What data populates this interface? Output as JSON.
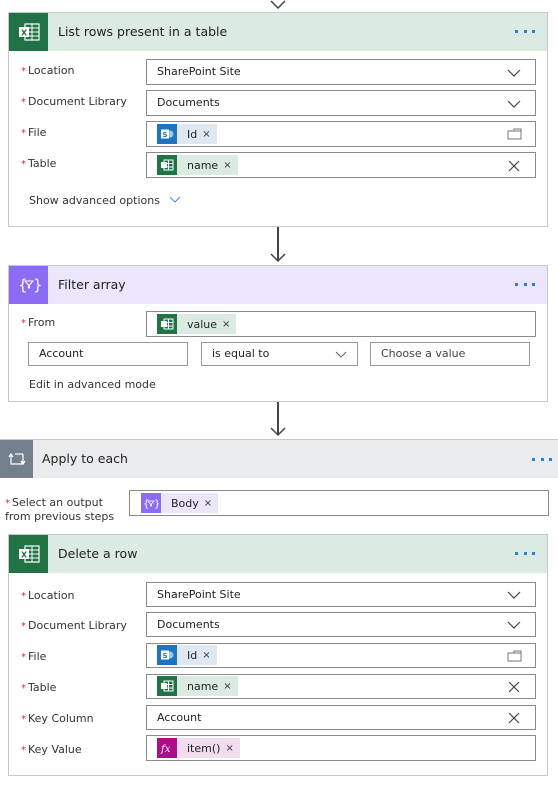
{
  "colors": {
    "excel_green": "#217346",
    "excel_header_bg": "#dcebe2",
    "filter_purple": "#8c6cf2",
    "filter_header_bg": "#ebe6fb",
    "loop_gray": "#737f8c",
    "loop_header_bg": "#eaebed",
    "sharepoint_blue": "#1f74bd",
    "sharepoint_token_bg": "#dde8f3",
    "excel_token_bg": "#dcebe2",
    "filter_token_bg": "#ebe6fb",
    "expression_magenta": "#ad0e8c",
    "expression_token_bg": "#f2dcef",
    "more_dots": "#2b7cd3",
    "required": "#d1322f"
  },
  "list_rows": {
    "title": "List rows present in a table",
    "icon": "excel-icon",
    "fields": [
      {
        "label": "Location",
        "required": true,
        "value": "SharePoint Site",
        "end_icon": "chevron-down-icon"
      },
      {
        "label": "Document Library",
        "required": true,
        "value": "Documents",
        "end_icon": "chevron-down-icon"
      },
      {
        "label": "File",
        "required": true,
        "token": {
          "label": "Id",
          "icon": "sharepoint-icon"
        },
        "end_icon": "folder-icon"
      },
      {
        "label": "Table",
        "required": true,
        "token": {
          "label": "name",
          "icon": "excel-icon"
        },
        "end_icon": "close-icon"
      }
    ],
    "advanced_link": "Show advanced options"
  },
  "filter_array": {
    "title": "Filter array",
    "icon": "filter-array-icon",
    "from_label": "From",
    "from_token": {
      "label": "value",
      "icon": "excel-icon"
    },
    "condition": {
      "left_value": "Account",
      "operator": "is equal to",
      "right_placeholder": "Choose a value"
    },
    "advanced_link": "Edit in advanced mode"
  },
  "apply_to_each": {
    "title": "Apply to each",
    "icon": "loop-icon",
    "select_label_line1": "Select an output",
    "select_label_line2": "from previous steps",
    "select_token": {
      "label": "Body",
      "icon": "filter-array-icon"
    }
  },
  "delete_row": {
    "title": "Delete a row",
    "icon": "excel-icon",
    "fields": [
      {
        "label": "Location",
        "required": true,
        "value": "SharePoint Site",
        "end_icon": "chevron-down-icon"
      },
      {
        "label": "Document Library",
        "required": true,
        "value": "Documents",
        "end_icon": "chevron-down-icon"
      },
      {
        "label": "File",
        "required": true,
        "token": {
          "label": "Id",
          "icon": "sharepoint-icon"
        },
        "end_icon": "folder-icon"
      },
      {
        "label": "Table",
        "required": true,
        "token": {
          "label": "name",
          "icon": "excel-icon"
        },
        "end_icon": "close-icon"
      },
      {
        "label": "Key Column",
        "required": true,
        "value": "Account",
        "end_icon": "close-icon"
      },
      {
        "label": "Key Value",
        "required": true,
        "token": {
          "label": "item()",
          "icon": "expression-icon"
        }
      }
    ]
  },
  "required_mark": "*",
  "token_remove": "×"
}
